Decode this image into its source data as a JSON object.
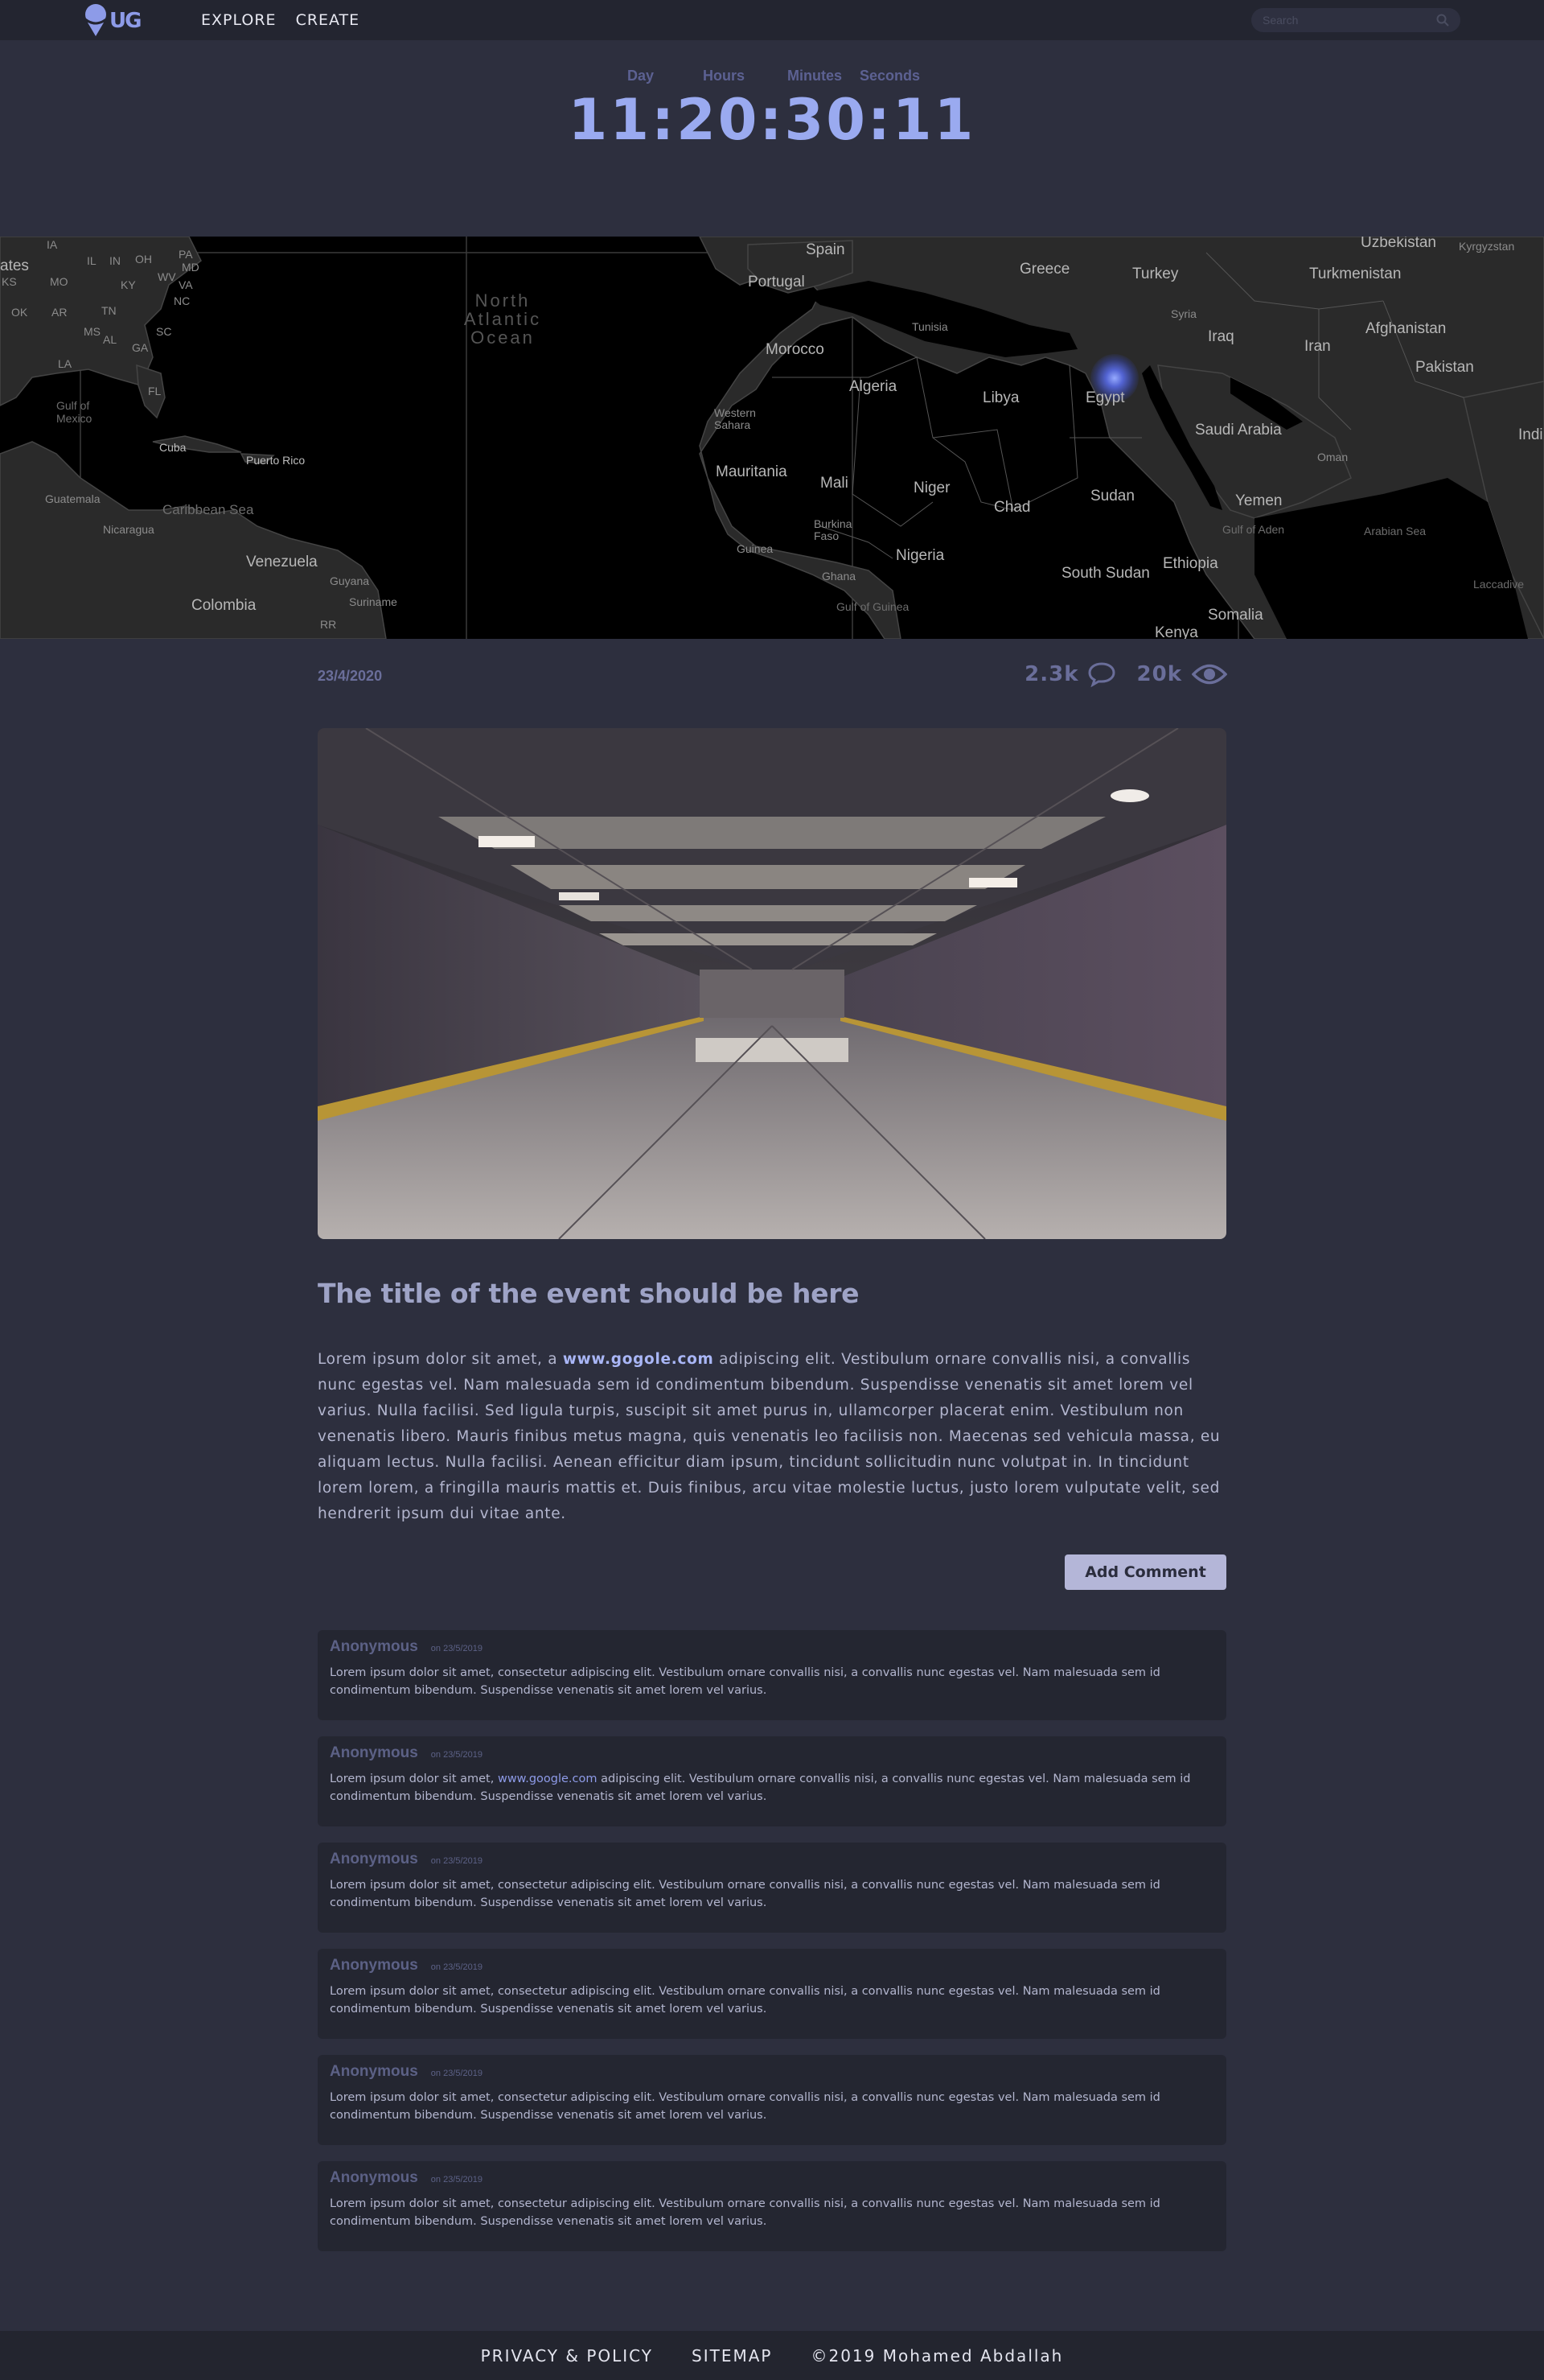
{
  "nav": {
    "logo_text": "UG",
    "links": [
      "EXPLORE",
      "CREATE"
    ],
    "search_placeholder": "Search"
  },
  "countdown": {
    "labels": {
      "day": "Day",
      "hours": "Hours",
      "minutes": "Minutes",
      "seconds": "Seconds"
    },
    "time": "11:20:30:11"
  },
  "map": {
    "marker_location": "Egypt",
    "labels": {
      "spain": "Spain",
      "portugal": "Portugal",
      "greece": "Greece",
      "turkey": "Turkey",
      "uzbekistan": "Uzbekistan",
      "kyrgyzstan": "Kyrgyzstan",
      "turkmenistan": "Turkmenistan",
      "tunisia": "Tunisia",
      "syria": "Syria",
      "iraq": "Iraq",
      "iran": "Iran",
      "afghanistan": "Afghanistan",
      "pakistan": "Pakistan",
      "morocco": "Morocco",
      "algeria": "Algeria",
      "libya": "Libya",
      "egypt": "Egypt",
      "western_sahara": "Western Sahara",
      "saudi_arabia": "Saudi Arabia",
      "oman": "Oman",
      "india": "Indi",
      "mauritania": "Mauritania",
      "mali": "Mali",
      "niger": "Niger",
      "chad": "Chad",
      "sudan": "Sudan",
      "yemen": "Yemen",
      "burkina_faso": "Burkina Faso",
      "guinea": "Guinea",
      "nigeria": "Nigeria",
      "ghana": "Ghana",
      "south_sudan": "South Sudan",
      "ethiopia": "Ethiopia",
      "gulf_of_aden": "Gulf of Aden",
      "arabian_sea": "Arabian Sea",
      "laccadive": "Laccadive",
      "gulf_of_guinea": "Gulf of Guinea",
      "kenya": "Kenya",
      "somalia": "Somalia",
      "north_atlantic_ocean": "North Atlantic Ocean",
      "states": "ates",
      "ks": "KS",
      "mo": "MO",
      "ok": "OK",
      "ar": "AR",
      "tn": "TN",
      "ms": "MS",
      "al": "AL",
      "ga": "GA",
      "sc": "SC",
      "la": "LA",
      "fl": "FL",
      "ia": "IA",
      "in": "IN",
      "oh": "OH",
      "pa": "PA",
      "ky": "KY",
      "wv": "WV",
      "va": "VA",
      "md": "MD",
      "il": "IL",
      "nc": "NC",
      "gulf_of_mexico": "Gulf of Mexico",
      "cuba": "Cuba",
      "puerto_rico": "Puerto Rico",
      "guatemala": "Guatemala",
      "caribbean_sea": "Caribbean Sea",
      "nicaragua": "Nicaragua",
      "venezuela": "Venezuela",
      "guyana": "Guyana",
      "suriname": "Suriname",
      "colombia": "Colombia",
      "rr": "RR"
    }
  },
  "event": {
    "date": "23/4/2020",
    "comments_count": "2.3k",
    "views_count": "20k",
    "title": "The title of the event should be here",
    "body_before_link": "Lorem ipsum dolor sit amet, a ",
    "body_link": "www.gogole.com",
    "body_after_link": " adipiscing elit. Vestibulum ornare convallis nisi, a convallis nunc egestas vel. Nam malesuada sem id condimentum bibendum. Suspendisse venenatis sit amet lorem vel varius. Nulla facilisi. Sed ligula turpis, suscipit sit amet purus in, ullamcorper placerat enim. Vestibulum non venenatis libero. Mauris finibus metus magna, quis venenatis leo facilisis non. Maecenas sed vehicula massa, eu aliquam lectus. Nulla facilisi. Aenean efficitur diam ipsum, tincidunt sollicitudin nunc volutpat in. In tincidunt lorem lorem, a fringilla mauris mattis et. Duis finibus, arcu vitae molestie luctus, justo lorem vulputate velit, sed hendrerit ipsum dui vitae ante.",
    "add_comment_label": "Add Comment"
  },
  "comments": [
    {
      "author": "Anonymous",
      "date": "on 23/5/2019",
      "text_before": "Lorem ipsum dolor sit amet, consectetur adipiscing elit. Vestibulum ornare convallis nisi, a convallis nunc egestas vel. Nam malesuada sem id condimentum bibendum. Suspendisse venenatis sit amet lorem vel varius.",
      "link": "",
      "text_after": ""
    },
    {
      "author": "Anonymous",
      "date": "on 23/5/2019",
      "text_before": "Lorem ipsum dolor sit amet, ",
      "link": "www.google.com",
      "text_after": " adipiscing elit. Vestibulum ornare convallis nisi, a convallis nunc egestas vel. Nam malesuada sem id condimentum bibendum. Suspendisse venenatis sit amet lorem vel varius."
    },
    {
      "author": "Anonymous",
      "date": "on 23/5/2019",
      "text_before": "Lorem ipsum dolor sit amet, consectetur adipiscing elit. Vestibulum ornare convallis nisi, a convallis nunc egestas vel. Nam malesuada sem id condimentum bibendum. Suspendisse venenatis sit amet lorem vel varius.",
      "link": "",
      "text_after": ""
    },
    {
      "author": "Anonymous",
      "date": "on 23/5/2019",
      "text_before": "Lorem ipsum dolor sit amet, consectetur adipiscing elit. Vestibulum ornare convallis nisi, a convallis nunc egestas vel. Nam malesuada sem id condimentum bibendum. Suspendisse venenatis sit amet lorem vel varius.",
      "link": "",
      "text_after": ""
    },
    {
      "author": "Anonymous",
      "date": "on 23/5/2019",
      "text_before": "Lorem ipsum dolor sit amet, consectetur adipiscing elit. Vestibulum ornare convallis nisi, a convallis nunc egestas vel. Nam malesuada sem id condimentum bibendum. Suspendisse venenatis sit amet lorem vel varius.",
      "link": "",
      "text_after": ""
    },
    {
      "author": "Anonymous",
      "date": "on 23/5/2019",
      "text_before": "Lorem ipsum dolor sit amet, consectetur adipiscing elit. Vestibulum ornare convallis nisi, a convallis nunc egestas vel. Nam malesuada sem id condimentum bibendum. Suspendisse venenatis sit amet lorem vel varius.",
      "link": "",
      "text_after": ""
    }
  ],
  "footer": {
    "privacy": "PRIVACY & POLICY",
    "sitemap": "SITEMAP",
    "copyright": "©2019 Mohamed Abdallah"
  },
  "colors": {
    "background": "#2d2f3e",
    "nav": "#232530",
    "accent": "#9aaaf0",
    "muted": "#6a6e9a",
    "comment_bg": "#242631",
    "button": "#b4b6d8"
  },
  "icons": [
    "logo-pin-icon",
    "search-icon",
    "comment-icon",
    "eye-icon",
    "map-marker-icon"
  ]
}
